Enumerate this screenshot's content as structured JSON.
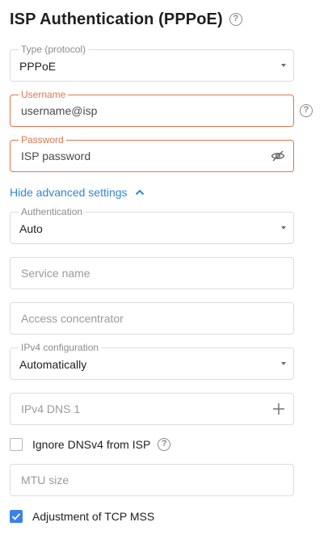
{
  "header": {
    "title": "ISP Authentication (PPPoE)"
  },
  "type_field": {
    "legend": "Type (protocol)",
    "value": "PPPoE"
  },
  "username_field": {
    "legend": "Username",
    "value": "username@isp"
  },
  "password_field": {
    "legend": "Password",
    "value": "ISP password"
  },
  "advanced": {
    "toggle_label": "Hide advanced settings"
  },
  "authentication_field": {
    "legend": "Authentication",
    "value": "Auto"
  },
  "service_name": {
    "placeholder": "Service name"
  },
  "access_concentrator": {
    "placeholder": "Access concentrator"
  },
  "ipv4_config": {
    "legend": "IPv4 configuration",
    "value": "Automatically"
  },
  "ipv4_dns1": {
    "placeholder": "IPv4 DNS 1"
  },
  "ignore_dns": {
    "label": "Ignore DNSv4 from ISP",
    "checked": false
  },
  "mtu": {
    "placeholder": "MTU size"
  },
  "tcp_mss": {
    "label": "Adjustment of TCP MSS",
    "checked": true
  },
  "colors": {
    "accent": "#2f87d8",
    "error": "#e0764f",
    "checkbox_checked": "#3b82e6"
  },
  "icons": [
    "help-icon",
    "dropdown-caret-icon",
    "eye-off-icon",
    "chevron-up-icon",
    "plus-icon",
    "check-icon"
  ]
}
